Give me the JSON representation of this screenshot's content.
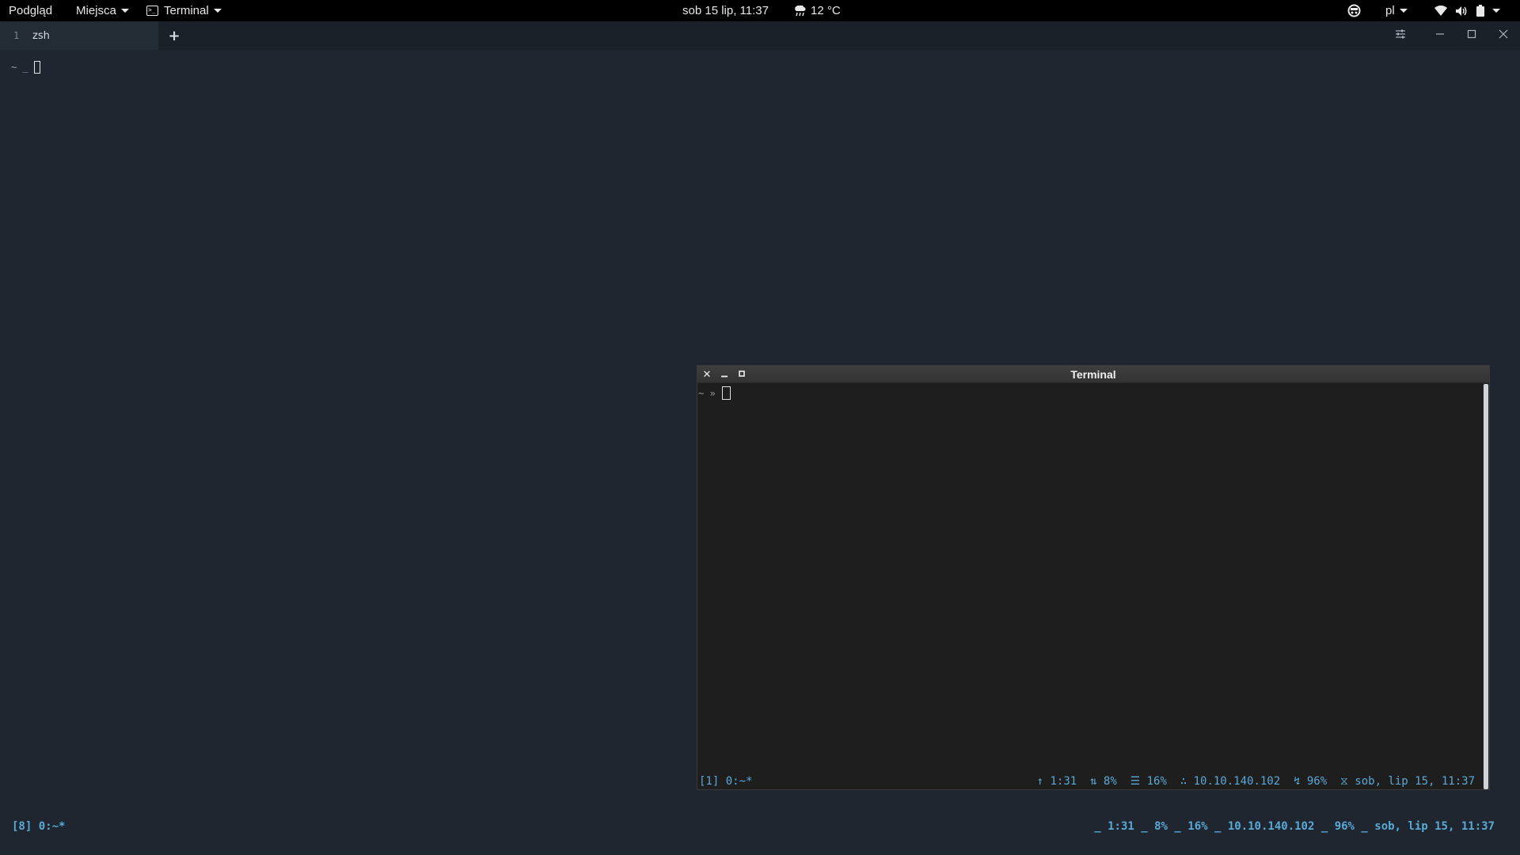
{
  "top_panel": {
    "activities": "Podgląd",
    "places": "Miejsca",
    "app_menu": "Terminal",
    "clock": "sob 15 lip, 11:37",
    "weather": "12 °C",
    "keyboard_layout": "pl",
    "icons": [
      "weather-rain-icon",
      "indicator-icon",
      "wifi-icon",
      "volume-icon",
      "battery-icon"
    ]
  },
  "main_terminal": {
    "tab": {
      "number": "1",
      "title": "zsh"
    },
    "new_tab": "+",
    "prompt": "~ _",
    "status_left": "[8] 0:~*",
    "status_right": "_ 1:31 _ 8% _ 16% _ 10.10.140.102 _ 96% _ sob, lip 15, 11:37"
  },
  "floating_terminal": {
    "title": "Terminal",
    "prompt": "~ »",
    "status_left": "[1] 0:~*",
    "status_right": "↑ 1:31  ⇅ 8%  ☰ 16%  ∴ 10.10.140.102  ↯ 96%  ⧖ sob, lip 15, 11:37"
  }
}
